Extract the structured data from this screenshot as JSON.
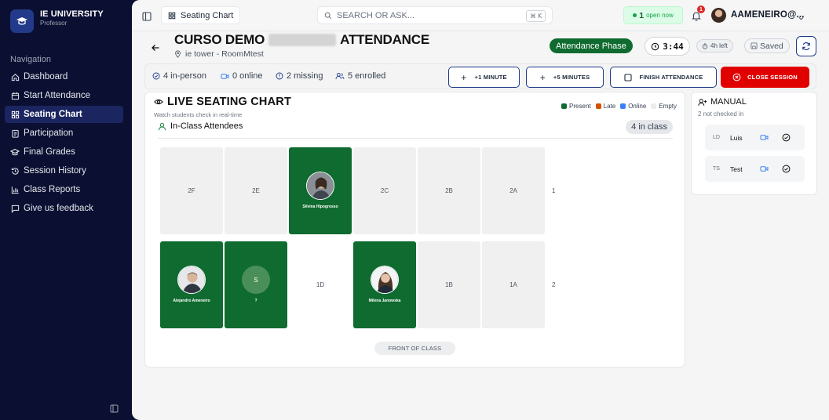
{
  "sidebar": {
    "brand_name": "IE UNIVERSITY",
    "brand_sub": "Professor",
    "nav_heading": "Navigation",
    "items": [
      {
        "label": "Dashboard",
        "icon": "home-icon"
      },
      {
        "label": "Start Attendance",
        "icon": "calendar-icon"
      },
      {
        "label": "Seating Chart",
        "icon": "grid-icon",
        "active": true
      },
      {
        "label": "Participation",
        "icon": "clipboard-icon"
      },
      {
        "label": "Final Grades",
        "icon": "graduation-cap-icon"
      },
      {
        "label": "Session History",
        "icon": "history-icon"
      },
      {
        "label": "Class Reports",
        "icon": "bar-chart-icon"
      },
      {
        "label": "Give us feedback",
        "icon": "message-icon"
      }
    ]
  },
  "topbar": {
    "page_label": "Seating Chart",
    "search_placeholder": "SEARCH OR ASK...",
    "shortcut": "⌘ K",
    "open_count": "1",
    "open_label": "open now",
    "notification_count": "1",
    "user_name": "AAMENEIRO@..."
  },
  "header": {
    "course_title_prefix": "CURSO DEMO",
    "course_title_suffix": "ATTENDANCE",
    "location": "ie tower - RoomMtest",
    "phase": "Attendance Phase",
    "timer": "3:44",
    "time_left": "4h left",
    "saved": "Saved"
  },
  "stats": {
    "in_person": "4 in-person",
    "online": "0 online",
    "missing": "2 missing",
    "enrolled": "5 enrolled",
    "btn_plus1": "+1 MINUTE",
    "btn_plus5": "+5 MINUTES",
    "btn_finish": "FINISH ATTENDANCE",
    "btn_close": "CLOSE SESSION"
  },
  "seating": {
    "title": "LIVE SEATING CHART",
    "subtitle": "Watch students check in real-time",
    "legend": [
      "Present",
      "Late",
      "Online",
      "Empty"
    ],
    "colors": {
      "present": "#0f6b2f",
      "late": "#d35400",
      "online": "#3b82f6",
      "empty": "#e5e7eb"
    },
    "attendees_label": "In-Class Attendees",
    "in_class_badge": "4 in class",
    "rows": [
      {
        "label": "1",
        "seats": [
          {
            "id": "2F",
            "status": "empty"
          },
          {
            "id": "2E",
            "status": "empty"
          },
          {
            "status": "present",
            "name": "Silvina Hipogrosso",
            "avatar": "photo"
          },
          {
            "id": "2C",
            "status": "empty"
          },
          {
            "id": "2B",
            "status": "empty"
          },
          {
            "id": "2A",
            "status": "empty"
          }
        ]
      },
      {
        "label": "2",
        "seats": [
          {
            "status": "present",
            "name": "Alejandro Ameneiro",
            "avatar": "photo"
          },
          {
            "status": "present",
            "name": "?",
            "initial": "S"
          },
          {
            "id": "1D",
            "status": "empty"
          },
          {
            "status": "present",
            "name": "Milena Janowska",
            "avatar": "photo"
          },
          {
            "id": "1B",
            "status": "empty"
          },
          {
            "id": "1A",
            "status": "empty"
          }
        ]
      }
    ],
    "front_label": "FRONT OF CLASS"
  },
  "manual": {
    "title": "MANUAL",
    "subtitle": "2 not checked in",
    "students": [
      {
        "initials": "LD",
        "name": "Luis"
      },
      {
        "initials": "TS",
        "name": "Test"
      }
    ]
  }
}
